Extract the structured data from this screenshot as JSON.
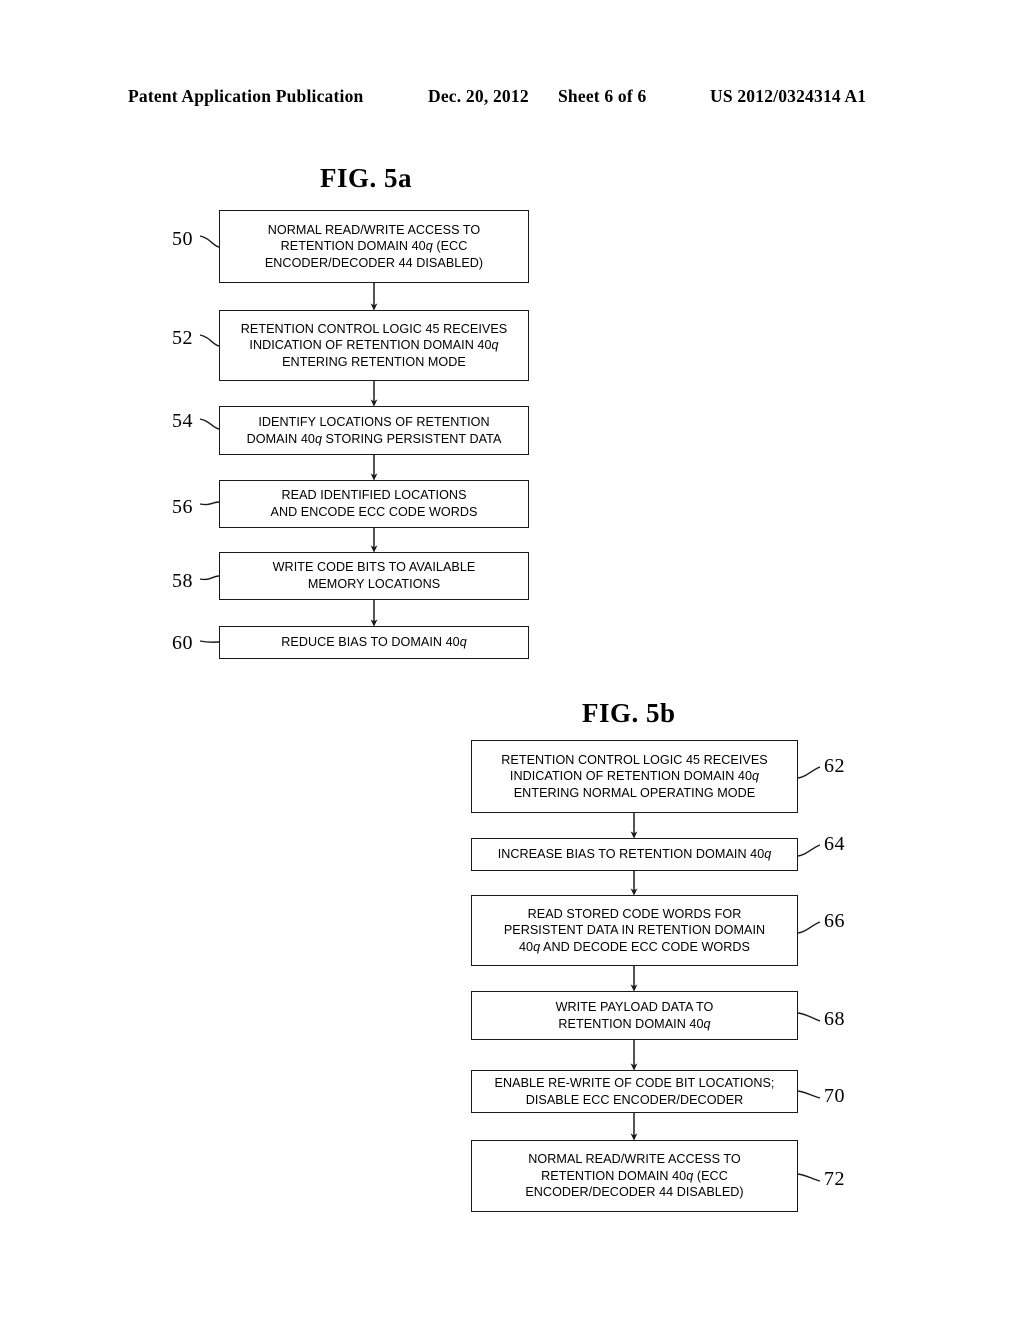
{
  "header": {
    "publication": "Patent Application Publication",
    "date": "Dec. 20, 2012",
    "sheet": "Sheet 6 of 6",
    "number": "US 2012/0324314 A1"
  },
  "figures": [
    {
      "id": "fig5a",
      "title": "FIG. 5a",
      "label_side": "left",
      "steps": [
        {
          "ref": "50",
          "text_html": "NORMAL READ/WRITE ACCESS TO\nRETENTION DOMAIN 40<i>q</i> (ECC\nENCODER/DECODER 44 DISABLED)",
          "text": "NORMAL READ/WRITE ACCESS TO RETENTION DOMAIN 40q (ECC ENCODER/DECODER 44 DISABLED)"
        },
        {
          "ref": "52",
          "text_html": "RETENTION CONTROL LOGIC 45 RECEIVES\nINDICATION OF RETENTION DOMAIN 40<i>q</i>\nENTERING RETENTION MODE",
          "text": "RETENTION CONTROL LOGIC 45 RECEIVES INDICATION OF RETENTION DOMAIN 40q ENTERING RETENTION MODE"
        },
        {
          "ref": "54",
          "text_html": "IDENTIFY LOCATIONS OF RETENTION\nDOMAIN 40<i>q</i> STORING PERSISTENT DATA",
          "text": "IDENTIFY LOCATIONS OF RETENTION DOMAIN 40q STORING PERSISTENT DATA"
        },
        {
          "ref": "56",
          "text_html": "READ IDENTIFIED LOCATIONS\nAND ENCODE ECC CODE WORDS",
          "text": "READ IDENTIFIED LOCATIONS AND ENCODE ECC CODE WORDS"
        },
        {
          "ref": "58",
          "text_html": "WRITE CODE BITS TO AVAILABLE\nMEMORY LOCATIONS",
          "text": "WRITE CODE BITS TO AVAILABLE MEMORY LOCATIONS"
        },
        {
          "ref": "60",
          "text_html": "REDUCE BIAS TO DOMAIN 40<i>q</i>",
          "text": "REDUCE BIAS TO DOMAIN 40q"
        }
      ]
    },
    {
      "id": "fig5b",
      "title": "FIG. 5b",
      "label_side": "right",
      "steps": [
        {
          "ref": "62",
          "text_html": "RETENTION CONTROL LOGIC 45 RECEIVES\nINDICATION OF RETENTION DOMAIN 40<i>q</i>\nENTERING NORMAL OPERATING MODE",
          "text": "RETENTION CONTROL LOGIC 45 RECEIVES INDICATION OF RETENTION DOMAIN 40q ENTERING NORMAL OPERATING MODE"
        },
        {
          "ref": "64",
          "text_html": "INCREASE BIAS TO RETENTION DOMAIN 40<i>q</i>",
          "text": "INCREASE BIAS TO RETENTION DOMAIN 40q"
        },
        {
          "ref": "66",
          "text_html": "READ STORED CODE WORDS FOR\nPERSISTENT DATA IN RETENTION DOMAIN\n40<i>q</i> AND DECODE ECC CODE WORDS",
          "text": "READ STORED CODE WORDS FOR PERSISTENT DATA IN RETENTION DOMAIN 40q AND DECODE ECC CODE WORDS"
        },
        {
          "ref": "68",
          "text_html": "WRITE PAYLOAD DATA TO\nRETENTION DOMAIN 40<i>q</i>",
          "text": "WRITE PAYLOAD DATA TO RETENTION DOMAIN 40q"
        },
        {
          "ref": "70",
          "text_html": "ENABLE RE-WRITE OF CODE BIT LOCATIONS;\nDISABLE ECC ENCODER/DECODER",
          "text": "ENABLE RE-WRITE OF CODE BIT LOCATIONS; DISABLE ECC ENCODER/DECODER"
        },
        {
          "ref": "72",
          "text_html": "NORMAL READ/WRITE ACCESS TO\nRETENTION DOMAIN 40<i>q</i> (ECC\nENCODER/DECODER 44 DISABLED)",
          "text": "NORMAL READ/WRITE ACCESS TO RETENTION DOMAIN 40q (ECC ENCODER/DECODER 44 DISABLED)"
        }
      ]
    }
  ],
  "colors": {
    "ink": "#000000",
    "paper": "#ffffff",
    "stroke": "#1a1a1a"
  }
}
